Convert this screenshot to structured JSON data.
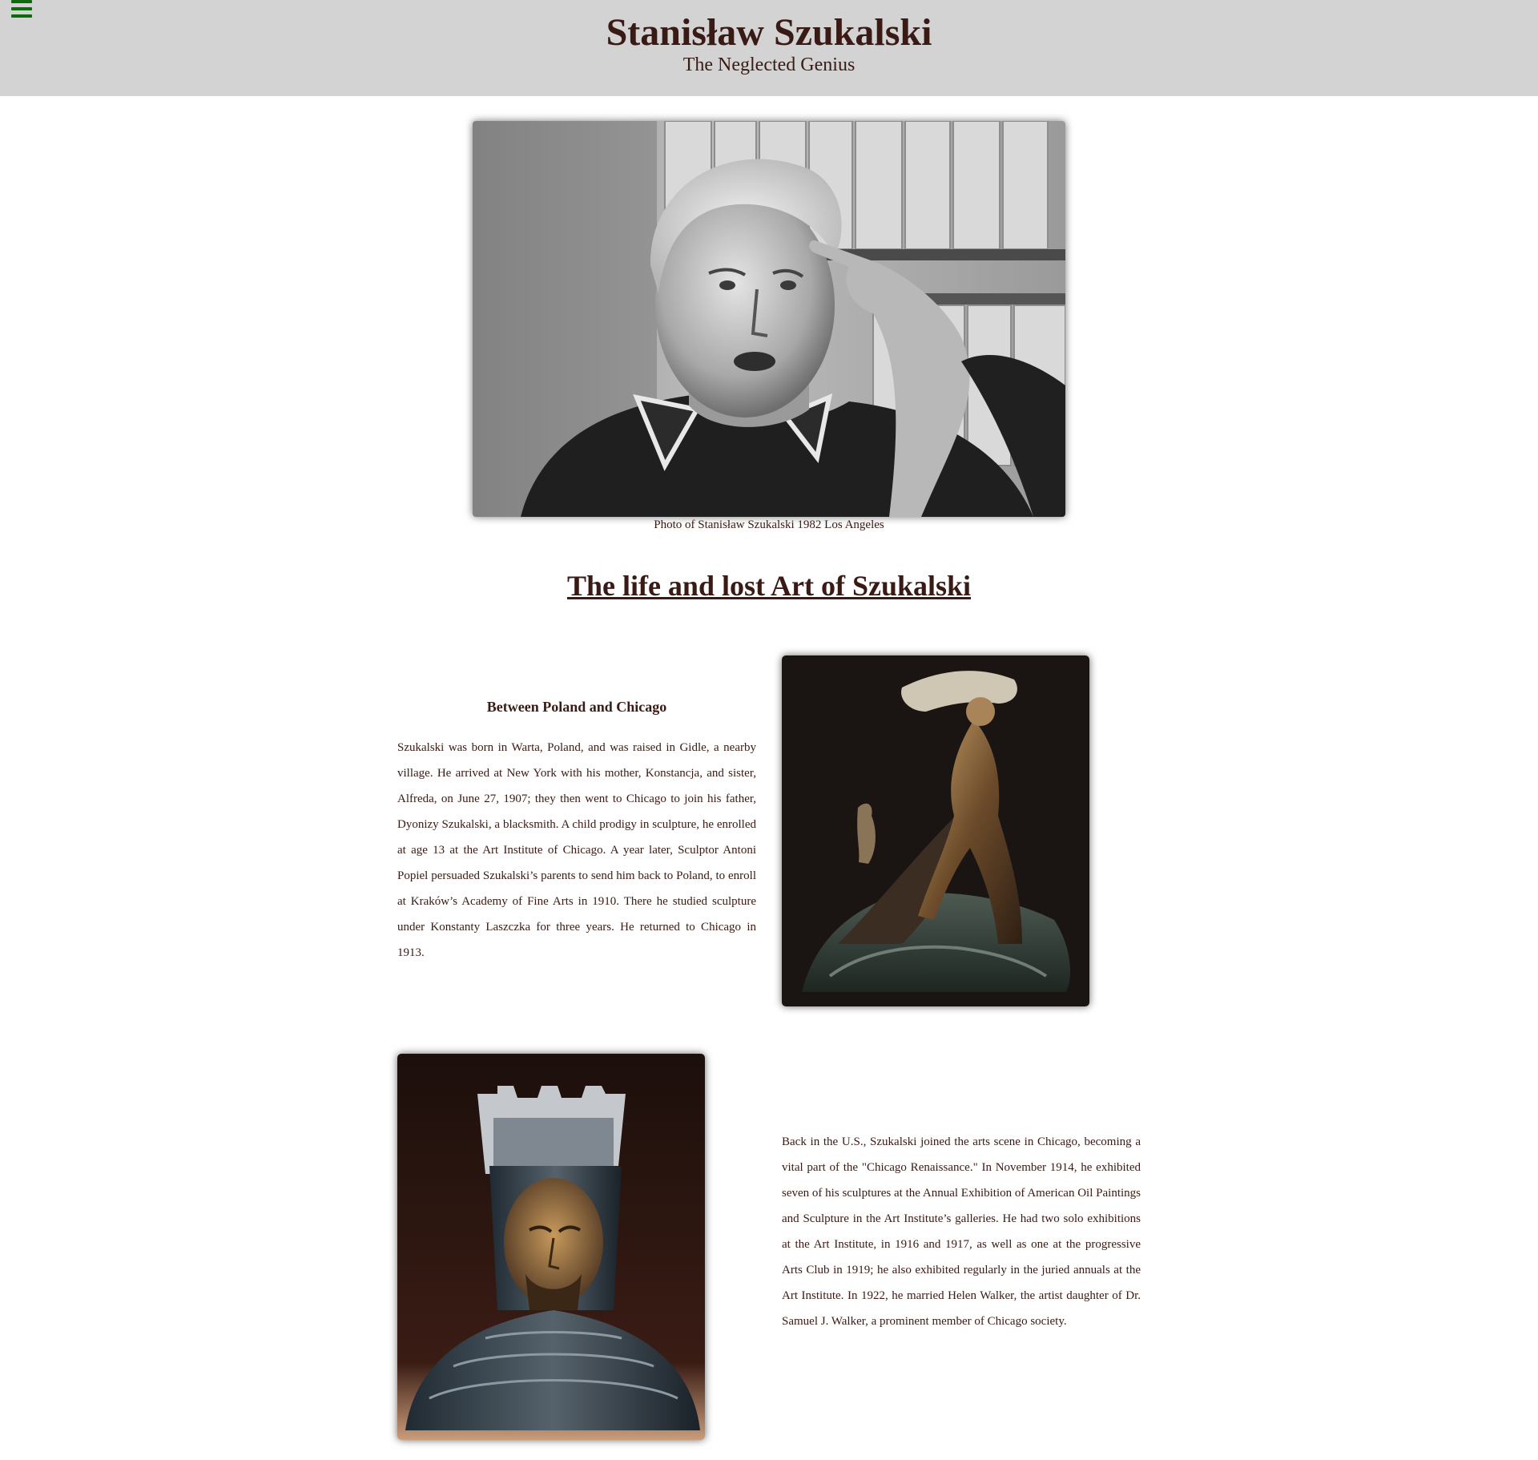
{
  "header": {
    "title": "Stanisław Szukalski",
    "subtitle": "The Neglected Genius",
    "menu_icon": "hamburger-menu-icon",
    "menu_icon_color": "#0c6a0c",
    "background": "#d3d3d3"
  },
  "hero": {
    "caption": "Photo of Stanisław Szukalski 1982 Los Angeles"
  },
  "main": {
    "heading": "The life and lost Art of Szukalski",
    "sections": [
      {
        "subheading": "Between Poland and Chicago",
        "text": "Szukalski was born in Warta, Poland, and was raised in Gidle, a nearby village. He arrived at New York with his mother, Konstancja, and sister, Alfreda, on June 27, 1907; they then went to Chicago to join his father, Dyonizy Szukalski, a blacksmith. A child prodigy in sculpture, he enrolled at age 13 at the Art Institute of Chicago. A year later, Sculptor Antoni Popiel persuaded Szukalski’s parents to send him back to Poland, to enroll at Kraków’s Academy of Fine Arts in 1910. There he studied sculpture under Konstanty Laszczka for three years. He returned to Chicago in 1913."
      },
      {
        "text": "Back in the U.S., Szukalski joined the arts scene in Chicago, becoming a vital part of the \"Chicago Renaissance.\" In November 1914, he exhibited seven of his sculptures at the Annual Exhibition of American Oil Paintings and Sculpture in the Art Institute’s galleries. He had two solo exhibitions at the Art Institute, in 1916 and 1917, as well as one at the progressive Arts Club in 1919; he also exhibited regularly in the juried annuals at the Art Institute. In 1922, he married Helen Walker, the artist daughter of Dr. Samuel J. Walker, a prominent member of Chicago society."
      }
    ]
  },
  "colors": {
    "text": "#3a1a14",
    "accent_green": "#0c6a0c"
  }
}
